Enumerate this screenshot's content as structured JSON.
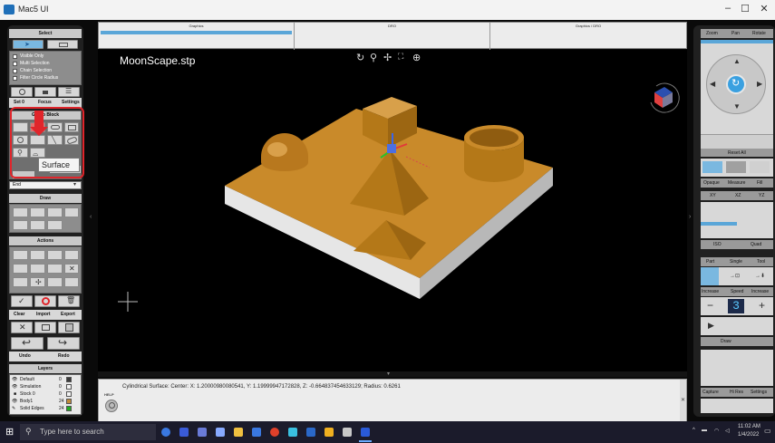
{
  "window": {
    "title": "Mac5 UI",
    "minimize": "–",
    "maximize": "☐",
    "close": "✕"
  },
  "left_panel": {
    "select": {
      "header": "Select",
      "options": [
        "Visible Only",
        "Multi Selection",
        "Chain Selection",
        "Filter Circle Radius"
      ],
      "tabs": [
        "Set 0",
        "Focus",
        "Settings"
      ]
    },
    "group_block": {
      "header": "Group Block",
      "tooltip": "Surface",
      "dropdown_value": "End"
    },
    "draw": {
      "header": "Draw"
    },
    "actions": {
      "header": "Actions"
    },
    "file": {
      "labels": [
        "Clear",
        "Import",
        "Export"
      ],
      "undo": "Undo",
      "redo": "Redo"
    },
    "layers": {
      "header": "Layers",
      "rows": [
        {
          "name": "Default",
          "num": "0",
          "color": "#3a3a3a"
        },
        {
          "name": "Simulation",
          "num": "0",
          "color": "#f2f2f2"
        },
        {
          "name": "Stock 0",
          "num": "0",
          "color": "#f2f2f2"
        },
        {
          "name": "Body1",
          "num": "24",
          "color": "#c08a3a"
        },
        {
          "name": "Solid Edges",
          "num": "24",
          "color": "#22aa22"
        }
      ]
    }
  },
  "viewport": {
    "tabs": [
      "Graphics",
      "DRO",
      "Graphics / DRO"
    ],
    "filename": "MoonScape.stp",
    "tool_icons": [
      "rotate-icon",
      "zoom-icon",
      "pan-icon",
      "fit-icon",
      "zoom-window-icon"
    ]
  },
  "status": {
    "text": "Cylindrical Surface: Center: X: 1.20000980080541, Y: 1.19999947172828, Z: -0.664837454633129; Radius: 0.6261",
    "help": "HELP"
  },
  "right_panel": {
    "view_tabs": [
      "Zoom",
      "Pan",
      "Rotate"
    ],
    "reset_all": "Reset All",
    "view_modes": [
      "Opaque",
      "Measure",
      "Fill"
    ],
    "planes": [
      "XY",
      "XZ",
      "YZ"
    ],
    "iso_labels": [
      "ISO",
      "Quad"
    ],
    "jog_tabs": [
      "Part",
      "Single",
      "Tool"
    ],
    "speed_tabs": [
      "Increase",
      "Speed",
      "Increase"
    ],
    "speed_value": "3",
    "minus": "−",
    "plus": "+",
    "play": "▶",
    "draw_label": "Draw",
    "bottom_tabs": [
      "Capture",
      "Hi Res",
      "Settings"
    ]
  },
  "taskbar": {
    "search_placeholder": "Type here to search",
    "time": "11:02 AM",
    "date": "1/4/2022"
  }
}
